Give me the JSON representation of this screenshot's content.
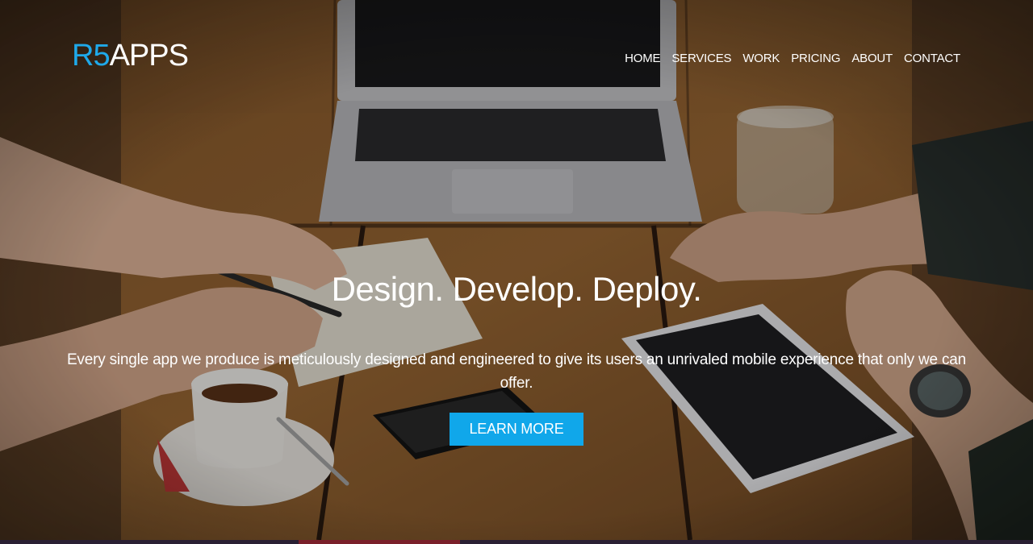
{
  "header": {
    "logo": {
      "part_a": "R5",
      "part_b": "APPS"
    },
    "nav": [
      {
        "label": "HOME"
      },
      {
        "label": "SERVICES"
      },
      {
        "label": "WORK"
      },
      {
        "label": "PRICING"
      },
      {
        "label": "ABOUT"
      },
      {
        "label": "CONTACT"
      }
    ]
  },
  "hero": {
    "headline": "Design. Develop. Deploy.",
    "subtext": "Every single app we produce is meticulously designed and engineered to give its users an unrivaled mobile experience that only we can offer.",
    "cta_label": "LEARN MORE",
    "background": "photo-of-desk-with-laptop-tablet-phone-coffee"
  },
  "colors": {
    "accent": "#10a7ea",
    "logo_blue": "#1fa9ea",
    "text": "#ffffff"
  }
}
